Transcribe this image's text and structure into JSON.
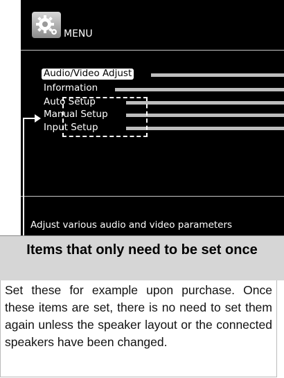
{
  "menu": {
    "title": "MENU",
    "items": [
      {
        "label": "Audio/Video Adjust",
        "selected": true
      },
      {
        "label": "Information",
        "selected": false
      },
      {
        "label": "Auto Setup",
        "selected": false
      },
      {
        "label": "Manual Setup",
        "selected": false
      },
      {
        "label": "Input Setup",
        "selected": false
      }
    ],
    "hint": "Adjust various audio and video parameters"
  },
  "callout": {
    "title": "Items that only need to be set once",
    "body": "Set these for example upon purchase. Once these items are set, there is no need to set them again unless the speaker layout or the connected speakers have been changed."
  },
  "colors": {
    "screen": "#000000",
    "header_bg": "#d6d6d6",
    "leader_line": "#bdbdbd"
  },
  "icons": [
    "gear-icon",
    "arrow-right-icon"
  ]
}
